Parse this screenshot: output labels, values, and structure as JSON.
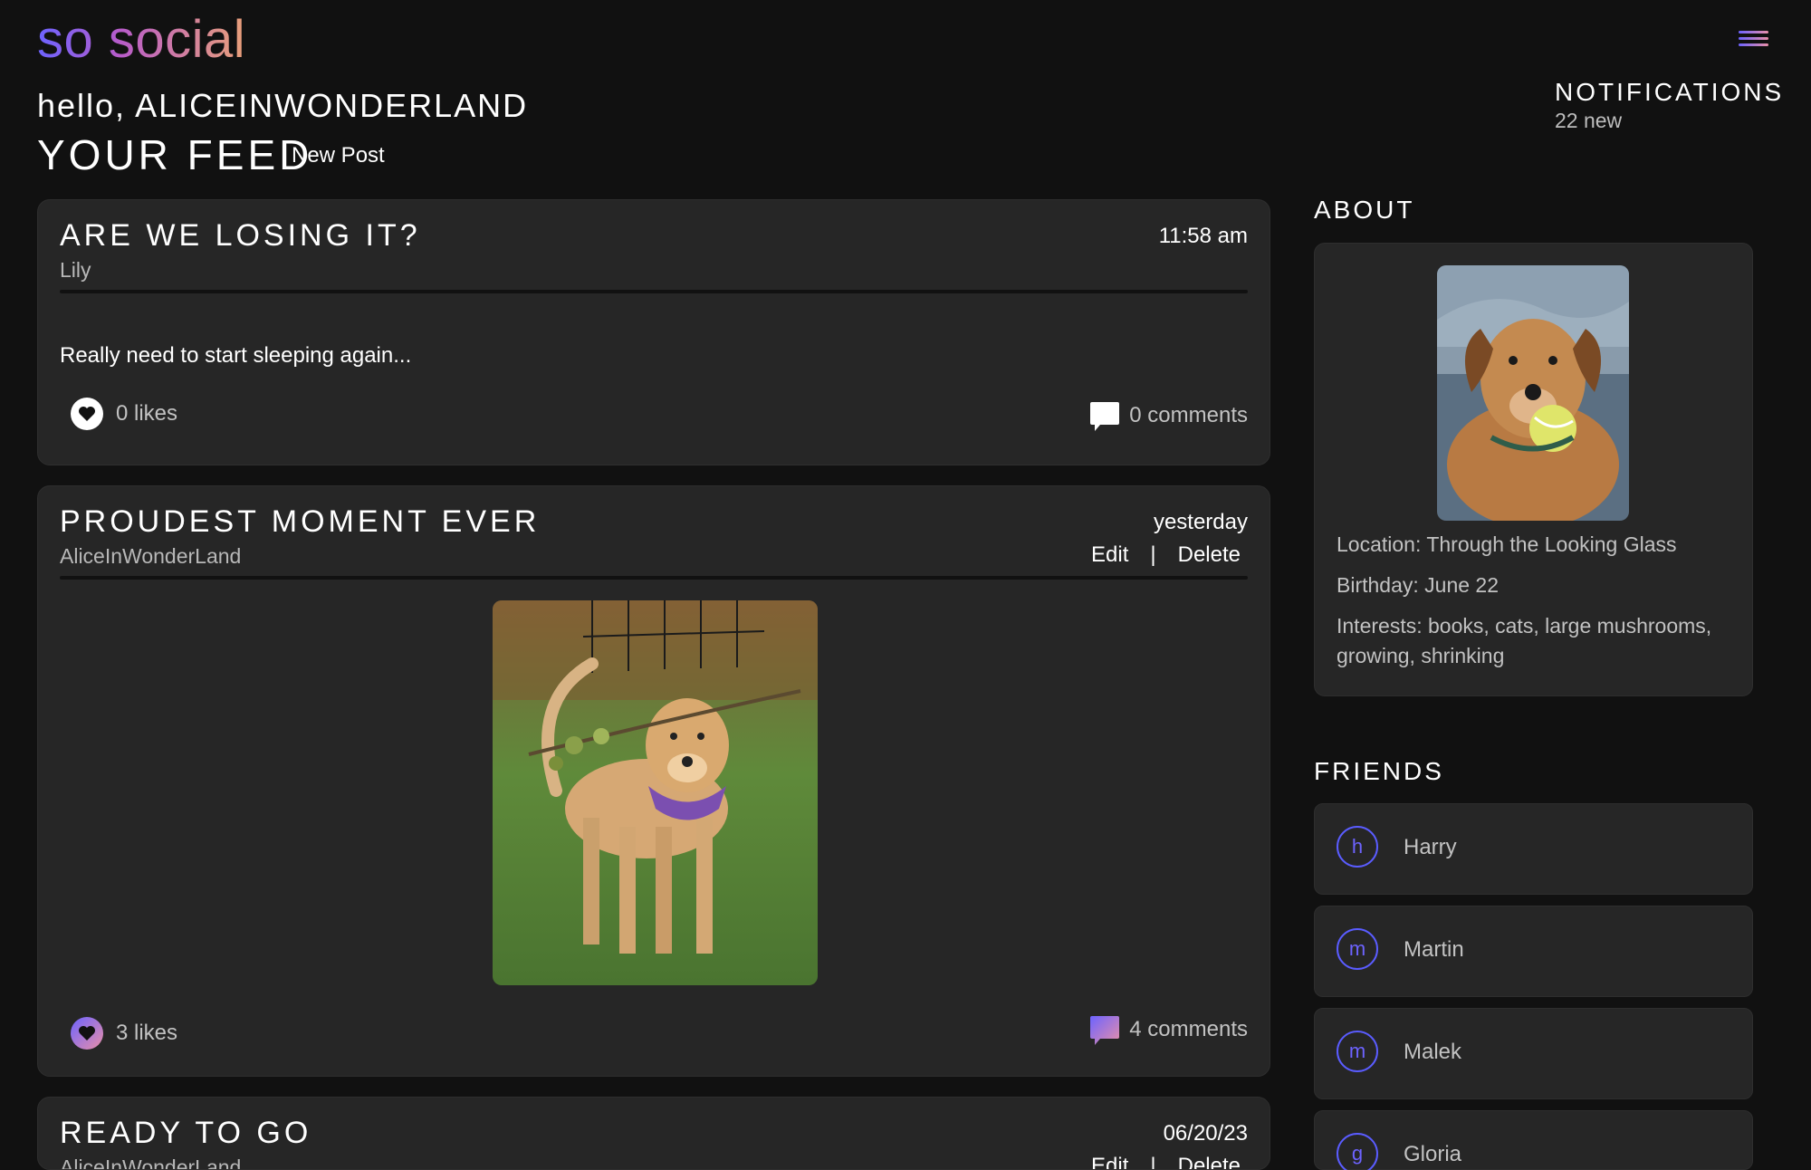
{
  "app": {
    "logo": "so social",
    "menu_icon": "hamburger-menu-icon"
  },
  "header": {
    "greeting": "hello, ALICEINWONDERLAND",
    "feed_title": "YOUR FEED",
    "new_post_label": "New Post",
    "notifications_label": "NOTIFICATIONS",
    "notifications_count": "22 new"
  },
  "posts": [
    {
      "title": "ARE WE LOSING IT?",
      "author": "Lily",
      "time": "11:58 am",
      "body": "Really need to start sleeping again...",
      "likes": "0 likes",
      "comments": "0 comments",
      "like_style": "white",
      "comment_style": "white"
    },
    {
      "title": "PROUDEST MOMENT EVER",
      "author": "AliceInWonderLand",
      "time": "yesterday",
      "edit_label": "Edit",
      "separator": "|",
      "delete_label": "Delete",
      "image": "dog-with-branch-photo",
      "likes": "3 likes",
      "comments": "4 comments",
      "like_style": "gradient",
      "comment_style": "gradient"
    },
    {
      "title": "READY TO GO",
      "author": "AliceInWonderLand",
      "time": "06/20/23",
      "edit_label": "Edit",
      "separator": "|",
      "delete_label": "Delete"
    }
  ],
  "about": {
    "heading": "ABOUT",
    "photo": "dog-with-ball-photo",
    "location": "Location: Through the Looking Glass",
    "birthday": "Birthday: June 22",
    "interests": "Interests: books, cats, large mushrooms, growing, shrinking"
  },
  "friends": {
    "heading": "FRIENDS",
    "items": [
      {
        "initial": "h",
        "name": "Harry"
      },
      {
        "initial": "m",
        "name": "Martin"
      },
      {
        "initial": "m",
        "name": "Malek"
      },
      {
        "initial": "g",
        "name": "Gloria"
      }
    ]
  },
  "colors": {
    "background": "#111111",
    "card": "#262626",
    "accent_start": "#6d63ff",
    "accent_end": "#e98fa8",
    "muted_text": "#c2c2c2"
  }
}
